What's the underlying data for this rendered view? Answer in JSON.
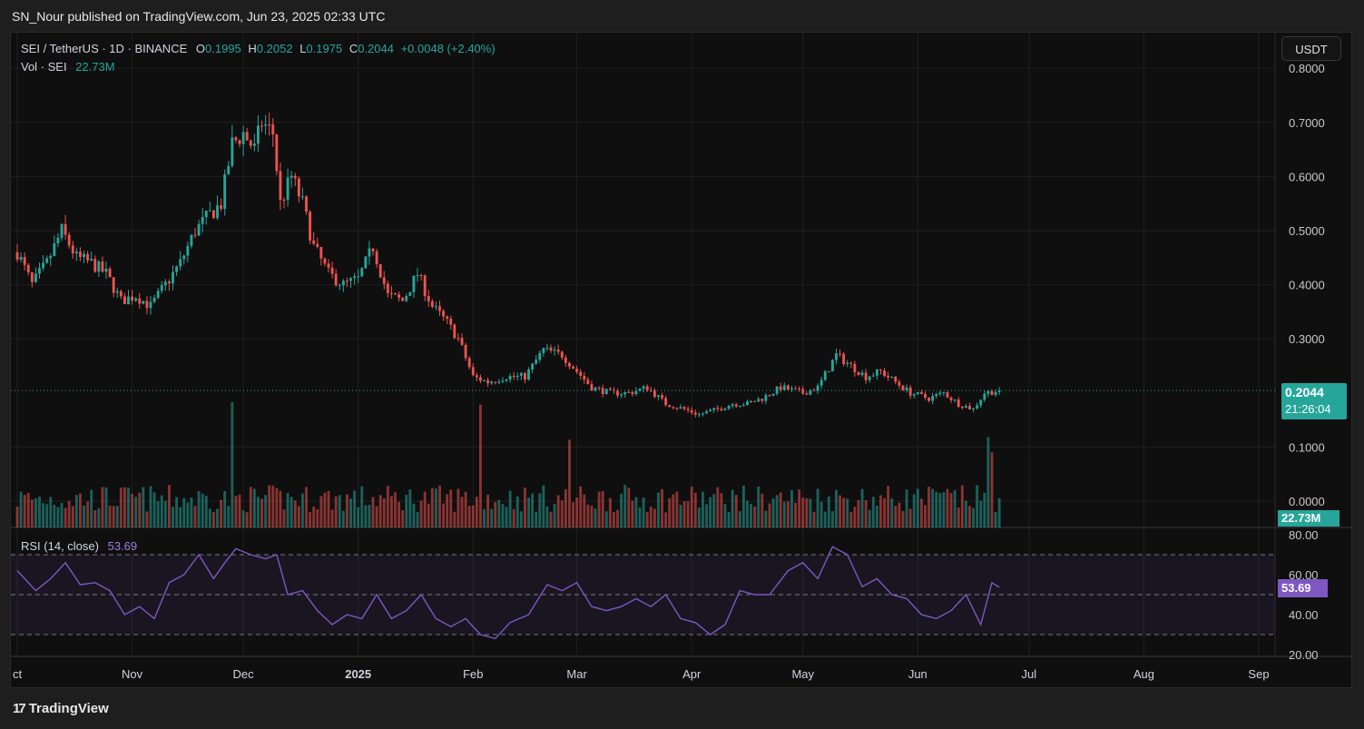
{
  "publisher_line": "SN_Nour published on TradingView.com, Jun 23, 2025 02:33 UTC",
  "brand": "TradingView",
  "brand_mark": "17",
  "colors": {
    "up": "#26a69a",
    "down": "#ef5350",
    "rsi": "#7e57c2",
    "bg": "#0f0f0f"
  },
  "legend": {
    "symbol": "SEI / TetherUS · 1D · BINANCE",
    "open_label": "O",
    "open": "0.1995",
    "high_label": "H",
    "high": "0.2052",
    "low_label": "L",
    "low": "0.1975",
    "close_label": "C",
    "close": "0.2044",
    "change": "+0.0048 (+2.40%)",
    "vol_label": "Vol · SEI",
    "vol": "22.73M"
  },
  "rsi_legend": {
    "label": "RSI (14, close)",
    "value": "53.69"
  },
  "currency_button": "USDT",
  "last_price_tag": {
    "price": "0.2044",
    "countdown": "21:26:04"
  },
  "volume_tag": "22.73M",
  "rsi_tag": "53.69",
  "chart_data": [
    {
      "type": "candlestick",
      "title": "SEI / TetherUS · 1D · BINANCE",
      "y_ticks": [
        "0.8000",
        "0.7000",
        "0.6000",
        "0.5000",
        "0.4000",
        "0.3000",
        "0.1000",
        "0.0000"
      ],
      "y_tick_values": [
        0.8,
        0.7,
        0.6,
        0.5,
        0.4,
        0.3,
        0.1,
        0.0
      ],
      "ylim": [
        0.0,
        0.8
      ],
      "x_ticks": [
        {
          "label": "ct",
          "date": "2024-10-01"
        },
        {
          "label": "Nov",
          "date": "2024-11-01"
        },
        {
          "label": "Dec",
          "date": "2024-12-01"
        },
        {
          "label": "2025",
          "date": "2025-01-01",
          "bold": true
        },
        {
          "label": "Feb",
          "date": "2025-02-01"
        },
        {
          "label": "Mar",
          "date": "2025-03-01"
        },
        {
          "label": "Apr",
          "date": "2025-04-01"
        },
        {
          "label": "May",
          "date": "2025-05-01"
        },
        {
          "label": "Jun",
          "date": "2025-06-01"
        },
        {
          "label": "Jul",
          "date": "2025-07-01"
        },
        {
          "label": "Aug",
          "date": "2025-08-01"
        },
        {
          "label": "Sep",
          "date": "2025-09-01"
        }
      ],
      "close_path": [
        [
          "2024-10-01",
          0.46
        ],
        [
          "2024-10-05",
          0.4
        ],
        [
          "2024-10-09",
          0.44
        ],
        [
          "2024-10-13",
          0.5
        ],
        [
          "2024-10-17",
          0.45
        ],
        [
          "2024-10-21",
          0.44
        ],
        [
          "2024-10-25",
          0.42
        ],
        [
          "2024-10-29",
          0.37
        ],
        [
          "2024-11-02",
          0.38
        ],
        [
          "2024-11-06",
          0.36
        ],
        [
          "2024-11-10",
          0.4
        ],
        [
          "2024-11-14",
          0.44
        ],
        [
          "2024-11-18",
          0.5
        ],
        [
          "2024-11-22",
          0.53
        ],
        [
          "2024-11-25",
          0.55
        ],
        [
          "2024-11-28",
          0.66
        ],
        [
          "2024-12-01",
          0.68
        ],
        [
          "2024-12-04",
          0.65
        ],
        [
          "2024-12-06",
          0.7
        ],
        [
          "2024-12-09",
          0.68
        ],
        [
          "2024-12-11",
          0.55
        ],
        [
          "2024-12-14",
          0.6
        ],
        [
          "2024-12-17",
          0.55
        ],
        [
          "2024-12-20",
          0.47
        ],
        [
          "2024-12-24",
          0.42
        ],
        [
          "2024-12-28",
          0.4
        ],
        [
          "2025-01-01",
          0.41
        ],
        [
          "2025-01-05",
          0.47
        ],
        [
          "2025-01-09",
          0.38
        ],
        [
          "2025-01-13",
          0.37
        ],
        [
          "2025-01-17",
          0.42
        ],
        [
          "2025-01-21",
          0.36
        ],
        [
          "2025-01-25",
          0.33
        ],
        [
          "2025-01-28",
          0.3
        ],
        [
          "2025-02-01",
          0.23
        ],
        [
          "2025-02-05",
          0.22
        ],
        [
          "2025-02-10",
          0.23
        ],
        [
          "2025-02-15",
          0.23
        ],
        [
          "2025-02-20",
          0.28
        ],
        [
          "2025-02-25",
          0.27
        ],
        [
          "2025-03-01",
          0.24
        ],
        [
          "2025-03-05",
          0.21
        ],
        [
          "2025-03-10",
          0.2
        ],
        [
          "2025-03-15",
          0.2
        ],
        [
          "2025-03-20",
          0.21
        ],
        [
          "2025-03-25",
          0.18
        ],
        [
          "2025-03-30",
          0.17
        ],
        [
          "2025-04-03",
          0.16
        ],
        [
          "2025-04-08",
          0.17
        ],
        [
          "2025-04-12",
          0.18
        ],
        [
          "2025-04-16",
          0.18
        ],
        [
          "2025-04-20",
          0.19
        ],
        [
          "2025-04-25",
          0.21
        ],
        [
          "2025-05-01",
          0.2
        ],
        [
          "2025-05-05",
          0.21
        ],
        [
          "2025-05-10",
          0.27
        ],
        [
          "2025-05-14",
          0.25
        ],
        [
          "2025-05-18",
          0.23
        ],
        [
          "2025-05-22",
          0.24
        ],
        [
          "2025-05-26",
          0.22
        ],
        [
          "2025-05-30",
          0.2
        ],
        [
          "2025-06-04",
          0.19
        ],
        [
          "2025-06-08",
          0.2
        ],
        [
          "2025-06-12",
          0.18
        ],
        [
          "2025-06-16",
          0.17
        ],
        [
          "2025-06-19",
          0.2
        ],
        [
          "2025-06-23",
          0.2044
        ]
      ],
      "last_price": 0.2044
    },
    {
      "type": "bar",
      "title": "Vol · SEI",
      "last_value": "22.73M",
      "series_note": "relative daily volume, 0-1",
      "spikes": [
        [
          "2024-11-28",
          1.0
        ],
        [
          "2025-02-03",
          0.98
        ],
        [
          "2025-02-27",
          0.7
        ],
        [
          "2025-06-20",
          0.72
        ],
        [
          "2025-06-21",
          0.6
        ]
      ]
    },
    {
      "type": "line",
      "title": "RSI (14, close)",
      "y_ticks": [
        "80.00",
        "60.00",
        "40.00",
        "20.00"
      ],
      "y_tick_values": [
        80,
        60,
        40,
        20
      ],
      "bands": [
        70,
        50,
        30
      ],
      "ylim": [
        20,
        80
      ],
      "points": [
        [
          "2024-10-01",
          62
        ],
        [
          "2024-10-06",
          52
        ],
        [
          "2024-10-10",
          58
        ],
        [
          "2024-10-14",
          66
        ],
        [
          "2024-10-18",
          55
        ],
        [
          "2024-10-22",
          56
        ],
        [
          "2024-10-26",
          52
        ],
        [
          "2024-10-30",
          40
        ],
        [
          "2024-11-03",
          44
        ],
        [
          "2024-11-07",
          38
        ],
        [
          "2024-11-11",
          56
        ],
        [
          "2024-11-15",
          60
        ],
        [
          "2024-11-19",
          70
        ],
        [
          "2024-11-23",
          58
        ],
        [
          "2024-11-26",
          66
        ],
        [
          "2024-11-29",
          73
        ],
        [
          "2024-12-03",
          70
        ],
        [
          "2024-12-07",
          68
        ],
        [
          "2024-12-10",
          70
        ],
        [
          "2024-12-13",
          50
        ],
        [
          "2024-12-17",
          52
        ],
        [
          "2024-12-21",
          42
        ],
        [
          "2024-12-25",
          35
        ],
        [
          "2024-12-29",
          40
        ],
        [
          "2025-01-02",
          38
        ],
        [
          "2025-01-06",
          50
        ],
        [
          "2025-01-10",
          38
        ],
        [
          "2025-01-14",
          42
        ],
        [
          "2025-01-18",
          50
        ],
        [
          "2025-01-22",
          38
        ],
        [
          "2025-01-26",
          34
        ],
        [
          "2025-01-30",
          38
        ],
        [
          "2025-02-03",
          30
        ],
        [
          "2025-02-07",
          28
        ],
        [
          "2025-02-11",
          36
        ],
        [
          "2025-02-16",
          40
        ],
        [
          "2025-02-21",
          55
        ],
        [
          "2025-02-25",
          52
        ],
        [
          "2025-03-01",
          56
        ],
        [
          "2025-03-05",
          44
        ],
        [
          "2025-03-09",
          42
        ],
        [
          "2025-03-13",
          44
        ],
        [
          "2025-03-17",
          48
        ],
        [
          "2025-03-21",
          44
        ],
        [
          "2025-03-25",
          50
        ],
        [
          "2025-03-29",
          38
        ],
        [
          "2025-04-02",
          36
        ],
        [
          "2025-04-06",
          30
        ],
        [
          "2025-04-10",
          35
        ],
        [
          "2025-04-14",
          52
        ],
        [
          "2025-04-18",
          50
        ],
        [
          "2025-04-22",
          50
        ],
        [
          "2025-04-27",
          62
        ],
        [
          "2025-05-01",
          66
        ],
        [
          "2025-05-05",
          58
        ],
        [
          "2025-05-09",
          74
        ],
        [
          "2025-05-13",
          70
        ],
        [
          "2025-05-17",
          54
        ],
        [
          "2025-05-21",
          58
        ],
        [
          "2025-05-25",
          50
        ],
        [
          "2025-05-29",
          48
        ],
        [
          "2025-06-02",
          40
        ],
        [
          "2025-06-06",
          38
        ],
        [
          "2025-06-10",
          42
        ],
        [
          "2025-06-14",
          50
        ],
        [
          "2025-06-18",
          35
        ],
        [
          "2025-06-21",
          56
        ],
        [
          "2025-06-23",
          53.69
        ]
      ],
      "last_value": 53.69
    }
  ]
}
